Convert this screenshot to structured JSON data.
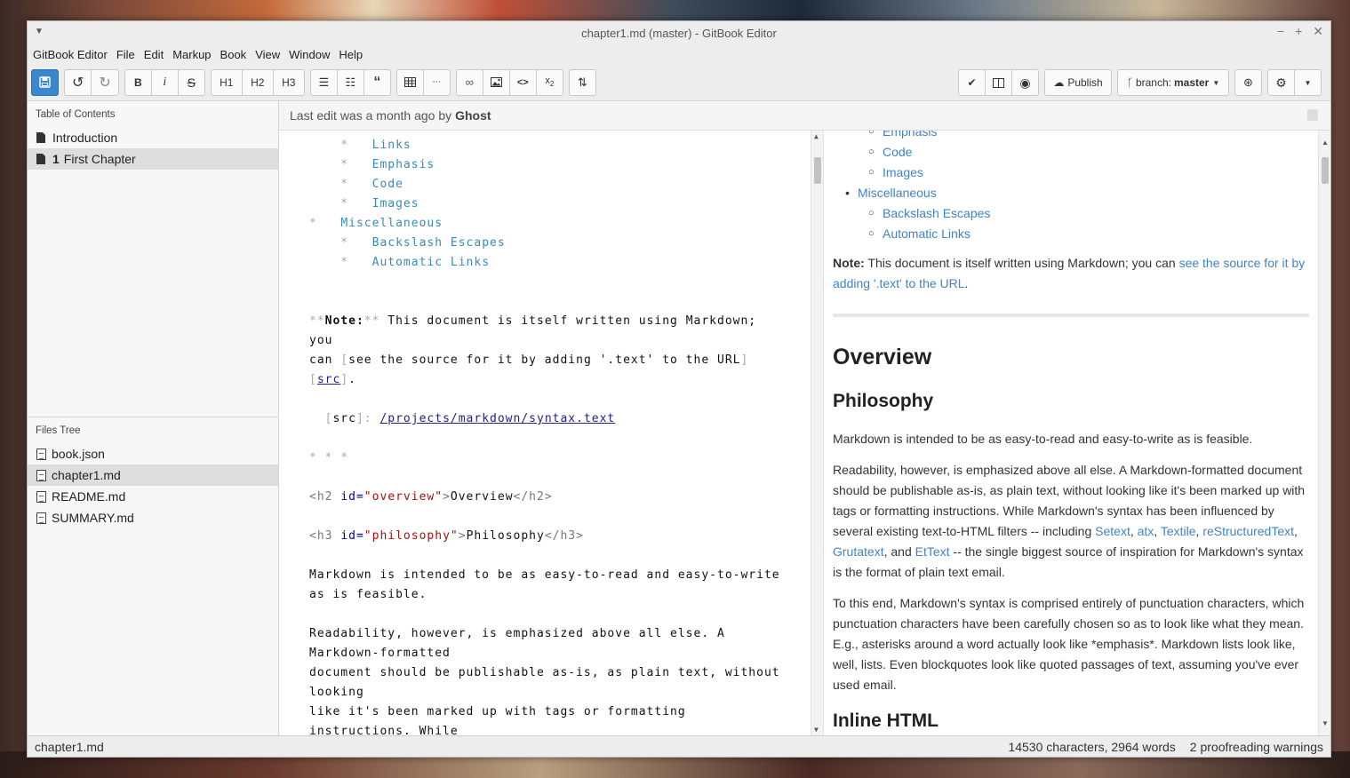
{
  "window": {
    "title": "chapter1.md (master) - GitBook Editor"
  },
  "menu": [
    "GitBook Editor",
    "File",
    "Edit",
    "Markup",
    "Book",
    "View",
    "Window",
    "Help"
  ],
  "toolbar": {
    "h1": "H1",
    "h2": "H2",
    "h3": "H3",
    "publish": "Publish",
    "branch_prefix": "branch:",
    "branch_name": "master"
  },
  "sidebar": {
    "toc_title": "Table of Contents",
    "toc": [
      {
        "num": "",
        "label": "Introduction"
      },
      {
        "num": "1",
        "label": "First Chapter"
      }
    ],
    "files_title": "Files Tree",
    "files": [
      "book.json",
      "chapter1.md",
      "README.md",
      "SUMMARY.md"
    ]
  },
  "editbar": {
    "text": "Last edit was a month ago by",
    "author": "Ghost"
  },
  "editor": {
    "list_items": [
      "Links",
      "Emphasis",
      "Code",
      "Images"
    ],
    "misc": "Miscellaneous",
    "misc_items": [
      "Backslash Escapes",
      "Automatic Links"
    ],
    "note_label": "Note:",
    "note_text1": " This document is itself written using Markdown;",
    "note_text2": "you",
    "note_text3": "can ",
    "note_link_text": "see the source for it by adding '.text' to the URL",
    "note_src": "src",
    "ref_label": "src",
    "ref_url": "/projects/markdown/syntax.text",
    "hr": "* * *",
    "h2_id": "overview",
    "h2_text": "Overview",
    "h3_id": "philosophy",
    "h3_text": "Philosophy",
    "para1_l1": "Markdown is intended to be as easy-to-read and easy-to-write",
    "para1_l2": "as is feasible.",
    "para2_l1": "Readability, however, is emphasized above all else. A",
    "para2_l2": "Markdown-formatted",
    "para2_l3": "document should be publishable as-is, as plain text, without",
    "para2_l4": "looking",
    "para2_l5": "like it's been marked up with tags or formatting",
    "para2_l6": "instructions. While"
  },
  "preview": {
    "top_items": [
      "Emphasis",
      "Code",
      "Images"
    ],
    "misc": "Miscellaneous",
    "misc_items": [
      "Backslash Escapes",
      "Automatic Links"
    ],
    "note_label": "Note:",
    "note_text": " This document is itself written using Markdown; you can ",
    "note_link": "see the source for it by adding '.text' to the URL",
    "overview": "Overview",
    "philosophy": "Philosophy",
    "p1": "Markdown is intended to be as easy-to-read and easy-to-write as is feasible.",
    "p2_a": "Readability, however, is emphasized above all else. A Markdown-formatted document should be publishable as-is, as plain text, without looking like it's been marked up with tags or formatting instructions. While Markdown's syntax has been influenced by several existing text-to-HTML filters -- including ",
    "p2_links": [
      "Setext",
      "atx",
      "Textile",
      "reStructuredText",
      "Grutatext",
      "EtText"
    ],
    "p2_and": ", and ",
    "p2_b": " -- the single biggest source of inspiration for Markdown's syntax is the format of plain text email.",
    "p3": "To this end, Markdown's syntax is comprised entirely of punctuation characters, which punctuation characters have been carefully chosen so as to look like what they mean. E.g., asterisks around a word actually look like *emphasis*. Markdown lists look like, well, lists. Even blockquotes look like quoted passages of text, assuming you've ever used email.",
    "inline_html": "Inline HTML"
  },
  "status": {
    "file": "chapter1.md",
    "counts": "14530 characters, 2964 words",
    "warnings": "2 proofreading warnings"
  },
  "colors": {
    "accent": "#3a87d0",
    "link": "#4183c4",
    "md_list": "#3a8ab8"
  }
}
